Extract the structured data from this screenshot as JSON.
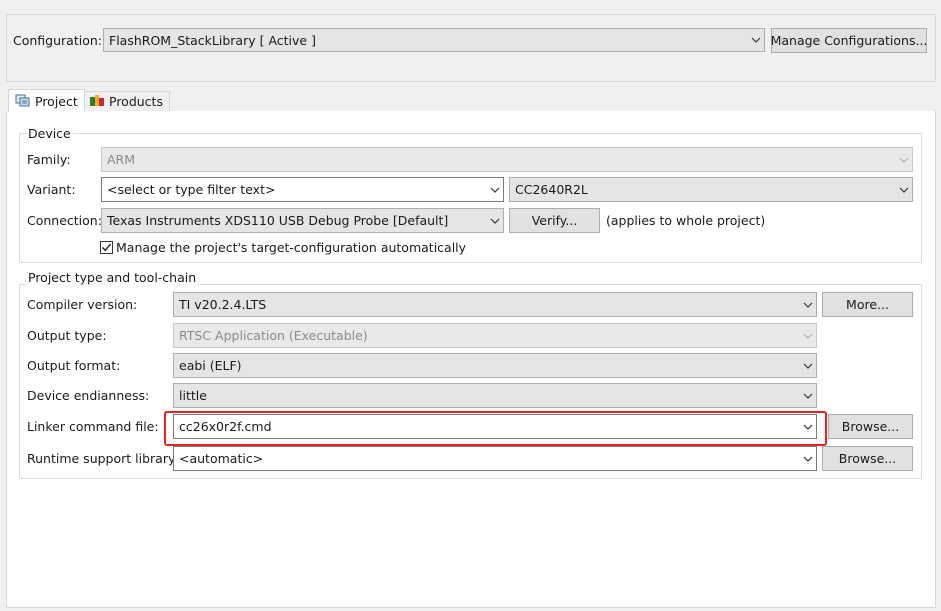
{
  "config": {
    "label": "Configuration:",
    "value": "FlashROM_StackLibrary  [ Active ]",
    "manage_button": "Manage Configurations..."
  },
  "tabs": [
    {
      "label": "Project",
      "active": true,
      "icon": "project-icon"
    },
    {
      "label": "Products",
      "active": false,
      "icon": "products-icon"
    }
  ],
  "device": {
    "title": "Device",
    "family_label": "Family:",
    "family_value": "ARM",
    "variant_label": "Variant:",
    "variant_filter": "<select or type filter text>",
    "variant_value": "CC2640R2L",
    "connection_label": "Connection:",
    "connection_value": "Texas Instruments XDS110 USB Debug Probe [Default]",
    "verify_button": "Verify...",
    "verify_note": "(applies to whole project)",
    "manage_checkbox_label": "Manage the project's target-configuration automatically",
    "manage_checkbox_checked": true
  },
  "toolchain": {
    "title": "Project type and tool-chain",
    "compiler_label": "Compiler version:",
    "compiler_value": "TI v20.2.4.LTS",
    "more_button": "More...",
    "output_type_label": "Output type:",
    "output_type_value": "RTSC Application (Executable)",
    "output_format_label": "Output format:",
    "output_format_value": "eabi (ELF)",
    "endianness_label": "Device endianness:",
    "endianness_value": "little",
    "linker_label": "Linker command file:",
    "linker_value": "cc26x0r2f.cmd",
    "linker_browse": "Browse...",
    "runtime_label": "Runtime support library:",
    "runtime_value": "<automatic>",
    "runtime_browse": "Browse..."
  },
  "colors": {
    "highlight": "#e8201f"
  }
}
